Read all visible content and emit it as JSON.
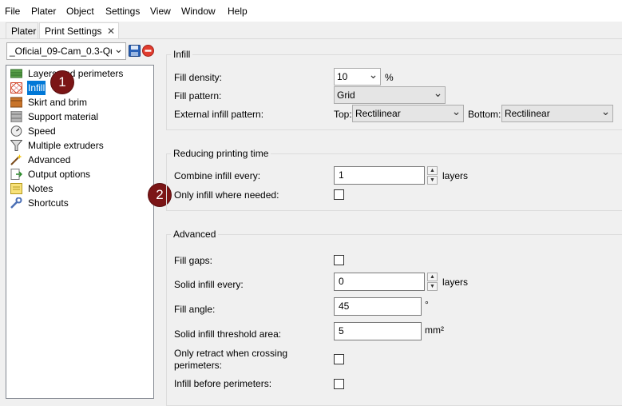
{
  "menu": [
    "File",
    "Plater",
    "Object",
    "Settings",
    "View",
    "Window",
    "Help"
  ],
  "tabs": {
    "plater": "Plater",
    "print_settings": "Print Settings",
    "close_glyph": "✕"
  },
  "preset": {
    "value": "_Oficial_09-Cam_0.3-Qu"
  },
  "tree": [
    {
      "label": "Layers and perimeters",
      "icon": "layers-icon"
    },
    {
      "label": "Infill",
      "icon": "infill-icon",
      "selected": true
    },
    {
      "label": "Skirt and brim",
      "icon": "skirt-icon"
    },
    {
      "label": "Support material",
      "icon": "support-icon"
    },
    {
      "label": "Speed",
      "icon": "speed-icon"
    },
    {
      "label": "Multiple extruders",
      "icon": "funnel-icon"
    },
    {
      "label": "Advanced",
      "icon": "wand-icon"
    },
    {
      "label": "Output options",
      "icon": "output-icon"
    },
    {
      "label": "Notes",
      "icon": "note-icon"
    },
    {
      "label": "Shortcuts",
      "icon": "wrench-icon"
    }
  ],
  "badges": [
    "1",
    "2"
  ],
  "infill": {
    "title": "Infill",
    "fill_density_label": "Fill density:",
    "fill_density_value": "10",
    "fill_density_unit": "%",
    "fill_pattern_label": "Fill pattern:",
    "fill_pattern_value": "Grid",
    "external_label": "External infill pattern:",
    "top_label": "Top:",
    "top_value": "Rectilinear",
    "bottom_label": "Bottom:",
    "bottom_value": "Rectilinear"
  },
  "reducing": {
    "title": "Reducing printing time",
    "combine_label": "Combine infill every:",
    "combine_value": "1",
    "combine_unit": "layers",
    "only_needed_label": "Only infill where needed:",
    "only_needed_checked": false
  },
  "advanced": {
    "title": "Advanced",
    "fill_gaps_label": "Fill gaps:",
    "fill_gaps_checked": false,
    "solid_every_label": "Solid infill every:",
    "solid_every_value": "0",
    "solid_every_unit": "layers",
    "fill_angle_label": "Fill angle:",
    "fill_angle_value": "45",
    "fill_angle_unit": "°",
    "threshold_label": "Solid infill threshold area:",
    "threshold_value": "5",
    "threshold_unit": "mm²",
    "retract_label_1": "Only retract when crossing",
    "retract_label_2": "perimeters:",
    "retract_checked": false,
    "before_perimeters_label": "Infill before perimeters:",
    "before_perimeters_checked": false
  },
  "colors": {
    "selection": "#0078d7",
    "badge": "#7b1516"
  }
}
